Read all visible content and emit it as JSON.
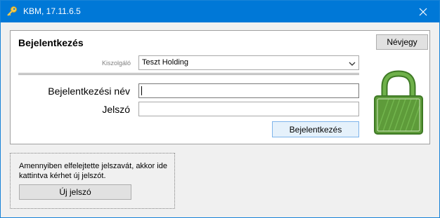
{
  "window": {
    "title": "KBM, 17.11.6.5",
    "icon": "key-icon",
    "close_icon": "close-icon"
  },
  "login_panel": {
    "title": "Bejelentkezés",
    "about_button": "Névjegy",
    "server_label": "Kiszolgáló",
    "server_selected": "Teszt Holding",
    "username_label": "Bejelentkezési név",
    "username_value": "",
    "password_label": "Jelszó",
    "password_value": "",
    "login_button": "Bejelentkezés",
    "lock_icon": "padlock-icon",
    "lock_color": "#5e9b3a"
  },
  "forgot_panel": {
    "text": "Amennyiben elfelejtette jelszavát, akkor ide kattintva kérhet új jelszót.",
    "new_password_button": "Új jelszó"
  },
  "colors": {
    "titlebar": "#0078d7",
    "accent_button": "#e5f1fb"
  }
}
